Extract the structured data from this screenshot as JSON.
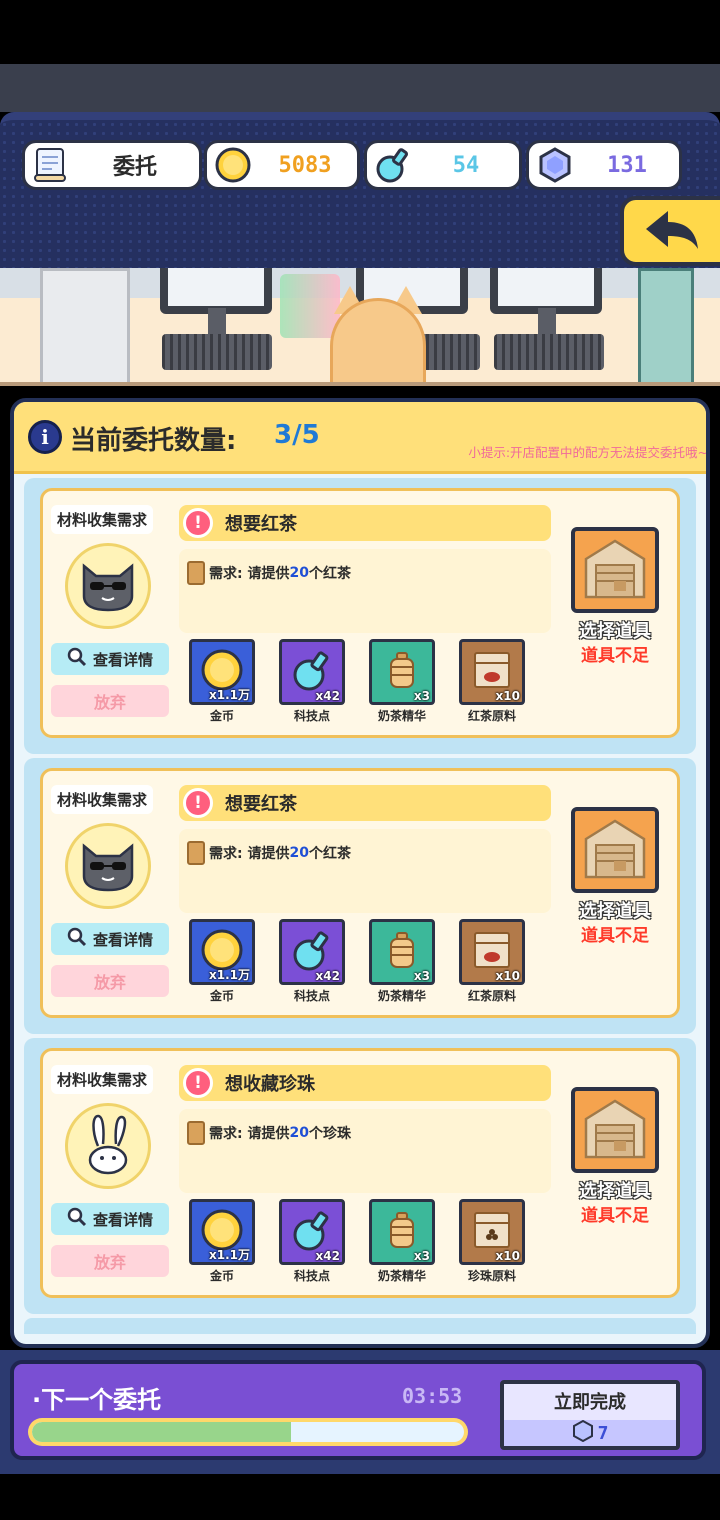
{
  "hud": {
    "title": "委托",
    "coins": "5083",
    "tech": "54",
    "gems": "131",
    "colors": {
      "coins": "#f0a020",
      "tech": "#5ac6e6",
      "gems": "#7a6ae0"
    }
  },
  "scene_icons": [
    "back-arrow-icon"
  ],
  "panel": {
    "count_label": "当前委托数量:",
    "count_value": "3/5",
    "tip": "小提示:开店配置中的配方无法提交委托哦~"
  },
  "cards": [
    {
      "tag": "材料收集需求",
      "avatar": "gray-cat-sunglasses",
      "title": "想要红茶",
      "need_prefix": "需求: 请提供",
      "need_num": "20",
      "need_suffix": "个红茶",
      "detail_label": "查看详情",
      "abandon_label": "放弃",
      "select_label": "选择道具",
      "insufficient_label": "道具不足",
      "rewards": [
        {
          "qty": "x1.1万",
          "label": "金币",
          "icon": "coin-icon",
          "color": "#3a5fd9"
        },
        {
          "qty": "x42",
          "label": "科技点",
          "icon": "flask-icon",
          "color": "#7b4fd6"
        },
        {
          "qty": "x3",
          "label": "奶茶精华",
          "icon": "milk-tea-essence-icon",
          "color": "#3cb89a"
        },
        {
          "qty": "x10",
          "label": "红茶原料",
          "icon": "black-tea-material-icon",
          "color": "#b27a4a"
        }
      ]
    },
    {
      "tag": "材料收集需求",
      "avatar": "gray-cat-sunglasses",
      "title": "想要红茶",
      "need_prefix": "需求: 请提供",
      "need_num": "20",
      "need_suffix": "个红茶",
      "detail_label": "查看详情",
      "abandon_label": "放弃",
      "select_label": "选择道具",
      "insufficient_label": "道具不足",
      "rewards": [
        {
          "qty": "x1.1万",
          "label": "金币",
          "icon": "coin-icon",
          "color": "#3a5fd9"
        },
        {
          "qty": "x42",
          "label": "科技点",
          "icon": "flask-icon",
          "color": "#7b4fd6"
        },
        {
          "qty": "x3",
          "label": "奶茶精华",
          "icon": "milk-tea-essence-icon",
          "color": "#3cb89a"
        },
        {
          "qty": "x10",
          "label": "红茶原料",
          "icon": "black-tea-material-icon",
          "color": "#b27a4a"
        }
      ]
    },
    {
      "tag": "材料收集需求",
      "avatar": "white-rabbit",
      "title": "想收藏珍珠",
      "need_prefix": "需求: 请提供",
      "need_num": "20",
      "need_suffix": "个珍珠",
      "detail_label": "查看详情",
      "abandon_label": "放弃",
      "select_label": "选择道具",
      "insufficient_label": "道具不足",
      "rewards": [
        {
          "qty": "x1.1万",
          "label": "金币",
          "icon": "coin-icon",
          "color": "#3a5fd9"
        },
        {
          "qty": "x42",
          "label": "科技点",
          "icon": "flask-icon",
          "color": "#7b4fd6"
        },
        {
          "qty": "x3",
          "label": "奶茶精华",
          "icon": "milk-tea-essence-icon",
          "color": "#3cb89a"
        },
        {
          "qty": "x10",
          "label": "珍珠原料",
          "icon": "pearl-material-icon",
          "color": "#b27a4a"
        }
      ]
    }
  ],
  "bottom": {
    "next_label": "·下一个委托",
    "timer": "03:53",
    "progress": 0.6,
    "finish_label": "立即完成",
    "finish_cost": "7"
  }
}
